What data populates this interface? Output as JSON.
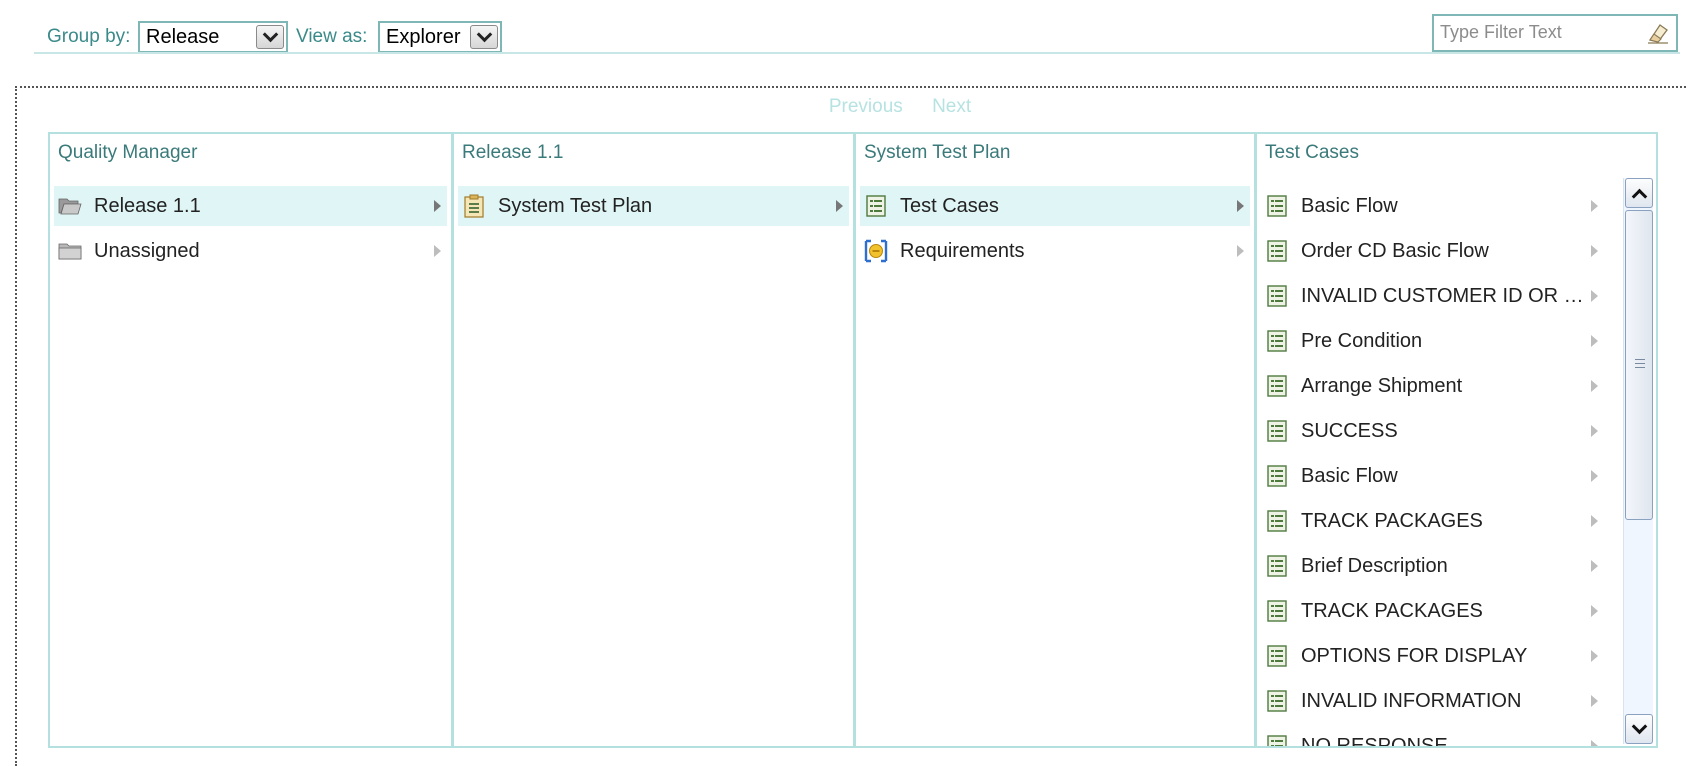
{
  "toolbar": {
    "group_by_label": "Group by:",
    "group_by_value": "Release",
    "view_as_label": "View as:",
    "view_as_value": "Explorer",
    "filter_placeholder": "Type Filter Text"
  },
  "pager": {
    "previous": "Previous",
    "next": "Next"
  },
  "columns": [
    {
      "title": "Quality Manager",
      "items": [
        {
          "label": "Release 1.1",
          "icon": "open-folder-icon",
          "selected": true
        },
        {
          "label": "Unassigned",
          "icon": "folder-icon",
          "selected": false
        }
      ]
    },
    {
      "title": "Release 1.1",
      "items": [
        {
          "label": "System Test Plan",
          "icon": "test-plan-icon",
          "selected": true
        }
      ]
    },
    {
      "title": "System Test Plan",
      "items": [
        {
          "label": "Test Cases",
          "icon": "test-case-icon",
          "selected": true
        },
        {
          "label": "Requirements",
          "icon": "requirements-icon",
          "selected": false
        }
      ]
    },
    {
      "title": "Test Cases",
      "items": [
        {
          "label": "Basic Flow",
          "icon": "test-case-icon"
        },
        {
          "label": "Order CD Basic Flow",
          "icon": "test-case-icon"
        },
        {
          "label": "INVALID CUSTOMER ID OR P...",
          "icon": "test-case-icon"
        },
        {
          "label": "Pre Condition",
          "icon": "test-case-icon"
        },
        {
          "label": "Arrange Shipment",
          "icon": "test-case-icon"
        },
        {
          "label": "SUCCESS",
          "icon": "test-case-icon"
        },
        {
          "label": "Basic Flow",
          "icon": "test-case-icon"
        },
        {
          "label": "TRACK PACKAGES",
          "icon": "test-case-icon"
        },
        {
          "label": "Brief Description",
          "icon": "test-case-icon"
        },
        {
          "label": "TRACK PACKAGES",
          "icon": "test-case-icon"
        },
        {
          "label": "OPTIONS FOR DISPLAY",
          "icon": "test-case-icon"
        },
        {
          "label": "INVALID INFORMATION",
          "icon": "test-case-icon"
        },
        {
          "label": "NO RESPONSE",
          "icon": "test-case-icon"
        }
      ]
    }
  ],
  "colors": {
    "accent": "#3b8a8a",
    "border": "#b4e0e0",
    "selected_row": "#e0f5f5",
    "pager_disabled": "#b7e2e2"
  }
}
